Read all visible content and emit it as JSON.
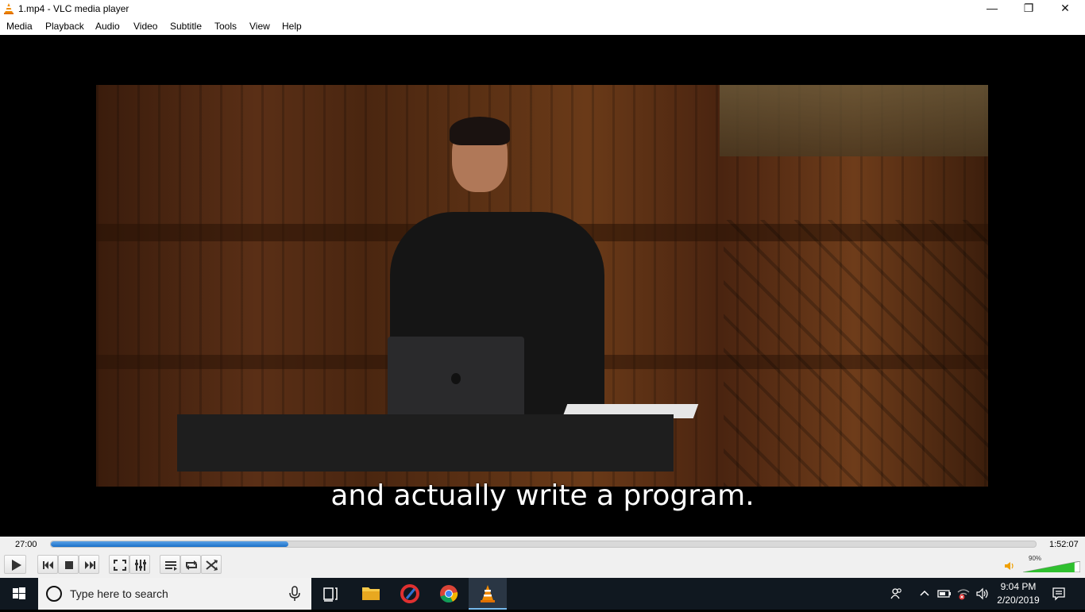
{
  "window": {
    "title": "1.mp4 - VLC media player"
  },
  "menu": [
    "Media",
    "Playback",
    "Audio",
    "Video",
    "Subtitle",
    "Tools",
    "View",
    "Help"
  ],
  "video": {
    "subtitle": "and actually write a program."
  },
  "playback": {
    "current_time": "27:00",
    "total_time": "1:52:07",
    "progress": 0.241
  },
  "volume": {
    "label": "90%",
    "level": 0.9
  },
  "taskbar": {
    "search_placeholder": "Type here to search",
    "time": "9:04 PM",
    "date": "2/20/2019",
    "pinned": [
      "task-view",
      "file-explorer",
      "ccleaner",
      "chrome",
      "vlc"
    ]
  },
  "colors": {
    "accent": "#1a6fc8",
    "taskbar_bg": "#101820",
    "volume_fill": "#2fc02f"
  }
}
